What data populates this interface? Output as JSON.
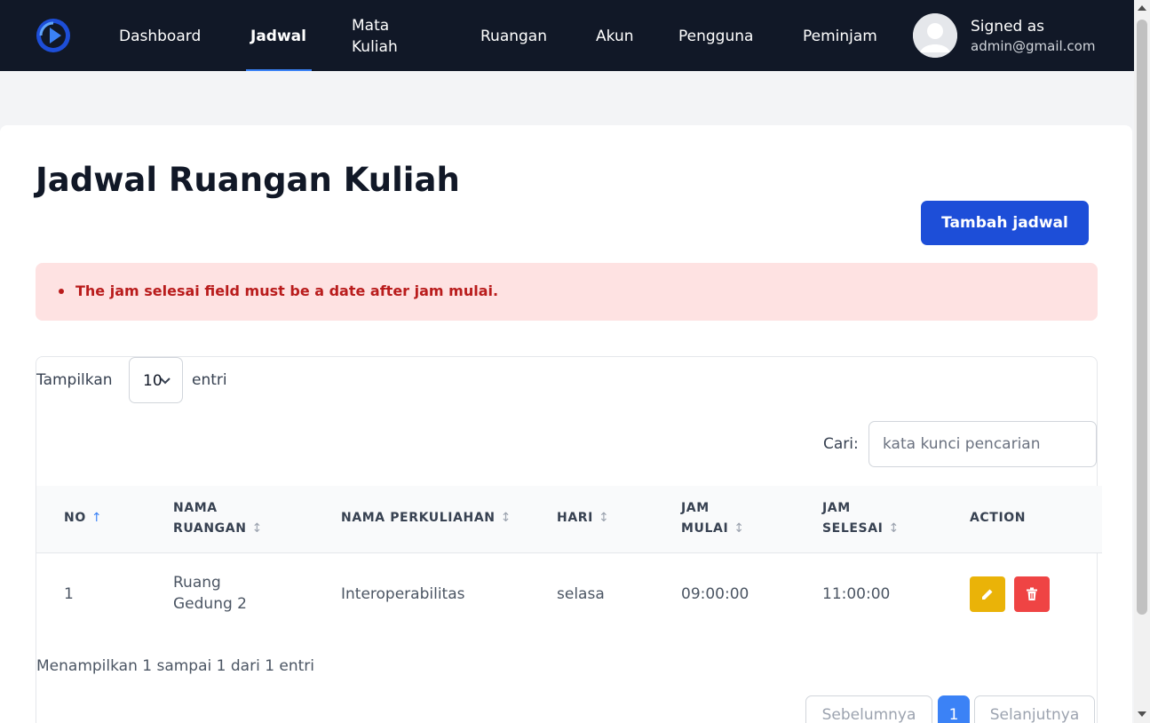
{
  "nav": {
    "items": [
      {
        "label": "Dashboard"
      },
      {
        "label": "Jadwal"
      },
      {
        "label_line1": "Mata",
        "label_line2": "Kuliah"
      },
      {
        "label": "Ruangan"
      },
      {
        "label": "Akun"
      },
      {
        "label": "Pengguna"
      },
      {
        "label": "Peminjam"
      }
    ],
    "active": "Jadwal",
    "user": {
      "signed_as": "Signed as",
      "email": "admin@gmail.com"
    }
  },
  "page": {
    "title": "Jadwal Ruangan Kuliah",
    "add_button": "Tambah jadwal"
  },
  "alert": {
    "message": "The jam selesai field must be a date after jam mulai."
  },
  "table_controls": {
    "show_label": "Tampilkan",
    "show_value": "10",
    "entries_label": "entri",
    "search_label": "Cari:",
    "search_placeholder": "kata kunci pencarian",
    "search_value": ""
  },
  "table": {
    "columns": [
      {
        "line1": "NO",
        "line2": ""
      },
      {
        "line1": "NAMA",
        "line2": "RUANGAN"
      },
      {
        "line1": "NAMA PERKULIAHAN",
        "line2": ""
      },
      {
        "line1": "HARI",
        "line2": ""
      },
      {
        "line1": "JAM",
        "line2": "MULAI"
      },
      {
        "line1": "JAM",
        "line2": "SELESAI"
      },
      {
        "line1": "ACTION",
        "line2": ""
      }
    ],
    "sort_icons": {
      "asc": "↑",
      "both": "↕"
    },
    "rows": [
      {
        "no": "1",
        "nama_ruangan_line1": "Ruang",
        "nama_ruangan_line2": "Gedung 2",
        "nama_perkuliahan": "Interoperabilitas",
        "hari": "selasa",
        "jam_mulai": "09:00:00",
        "jam_selesai": "11:00:00"
      }
    ]
  },
  "footer": {
    "info": "Menampilkan 1 sampai 1 dari 1 entri",
    "prev": "Sebelumnya",
    "page": "1",
    "next": "Selanjutnya"
  },
  "colors": {
    "navbar": "#111827",
    "primary": "#1d4ed8",
    "alert_bg": "#fee2e2",
    "alert_text": "#b91c1c",
    "edit": "#eab308",
    "delete": "#ef4444"
  }
}
